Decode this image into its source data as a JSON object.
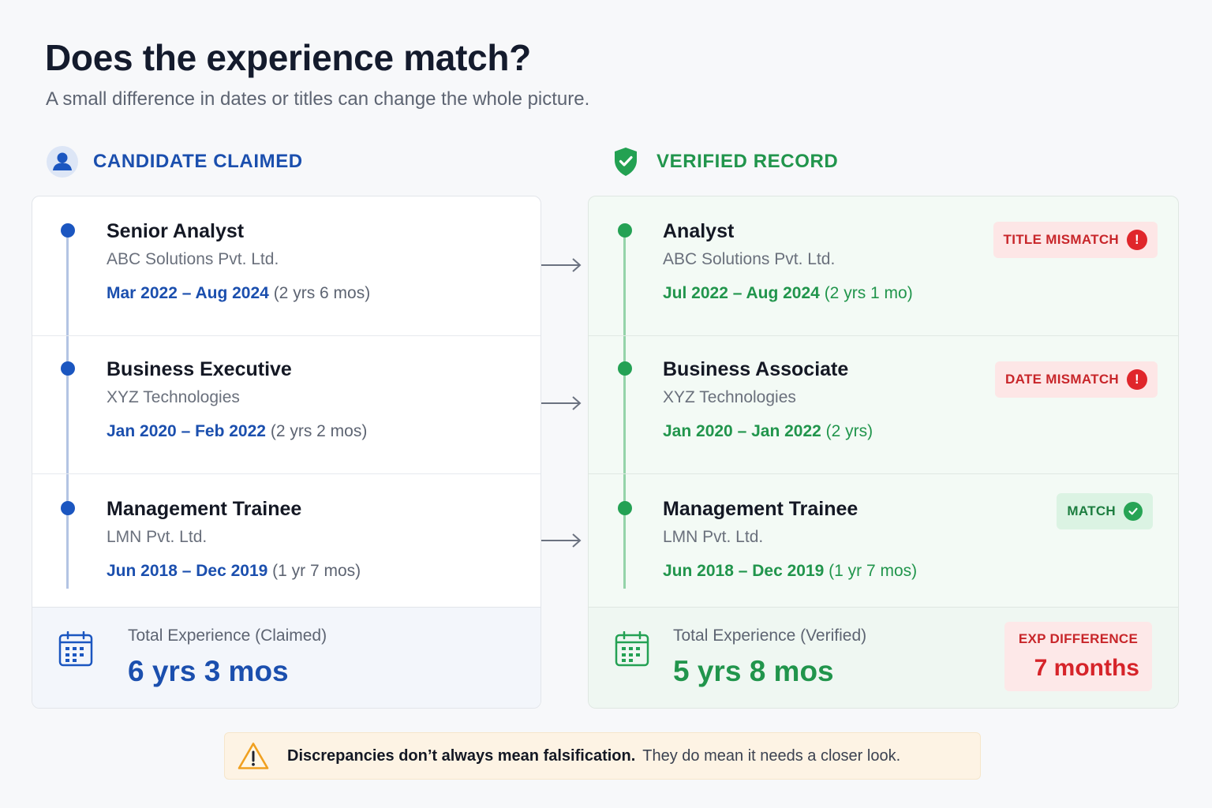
{
  "header": {
    "title": "Does the experience match?",
    "subtitle": "A small difference in dates or titles can change the whole picture."
  },
  "claimed": {
    "heading": "CANDIDATE CLAIMED",
    "icon": "user-icon",
    "entries": [
      {
        "role": "Senior Analyst",
        "company": "ABC Solutions Pvt. Ltd.",
        "range": "Mar 2022 – Aug 2024",
        "duration": "(2 yrs 6 mos)"
      },
      {
        "role": "Business Executive",
        "company": "XYZ Technologies",
        "range": "Jan 2020 – Feb 2022",
        "duration": "(2 yrs 2 mos)"
      },
      {
        "role": "Management Trainee",
        "company": "LMN Pvt. Ltd.",
        "range": "Jun 2018 – Dec 2019",
        "duration": "(1 yr 7 mos)"
      }
    ],
    "total_label": "Total Experience (Claimed)",
    "total_value": "6 yrs 3 mos"
  },
  "verified": {
    "heading": "VERIFIED RECORD",
    "icon": "shield-check-icon",
    "entries": [
      {
        "role": "Analyst",
        "company": "ABC Solutions Pvt. Ltd.",
        "range": "Jul 2022 – Aug 2024",
        "duration": "(2 yrs 1 mo)",
        "badge": "TITLE MISMATCH",
        "status": "mismatch"
      },
      {
        "role": "Business Associate",
        "company": "XYZ Technologies",
        "range": "Jan 2020 – Jan 2022",
        "duration": "(2 yrs)",
        "badge": "DATE MISMATCH",
        "status": "mismatch"
      },
      {
        "role": "Management Trainee",
        "company": "LMN Pvt. Ltd.",
        "range": "Jun 2018 – Dec 2019",
        "duration": "(1 yr 7 mos)",
        "badge": "MATCH",
        "status": "match"
      }
    ],
    "total_label": "Total Experience (Verified)",
    "total_value": "5 yrs 8 mos",
    "difference_label": "EXP DIFFERENCE",
    "difference_value": "7 months"
  },
  "notice": {
    "strong": "Discrepancies don’t always mean falsification.",
    "text": "They do mean it needs a closer look.",
    "icon": "warning-icon"
  },
  "colors": {
    "claimed_accent": "#1b4fae",
    "verified_accent": "#21954c",
    "mismatch": "#e0262b",
    "warning": "#f0a020"
  }
}
